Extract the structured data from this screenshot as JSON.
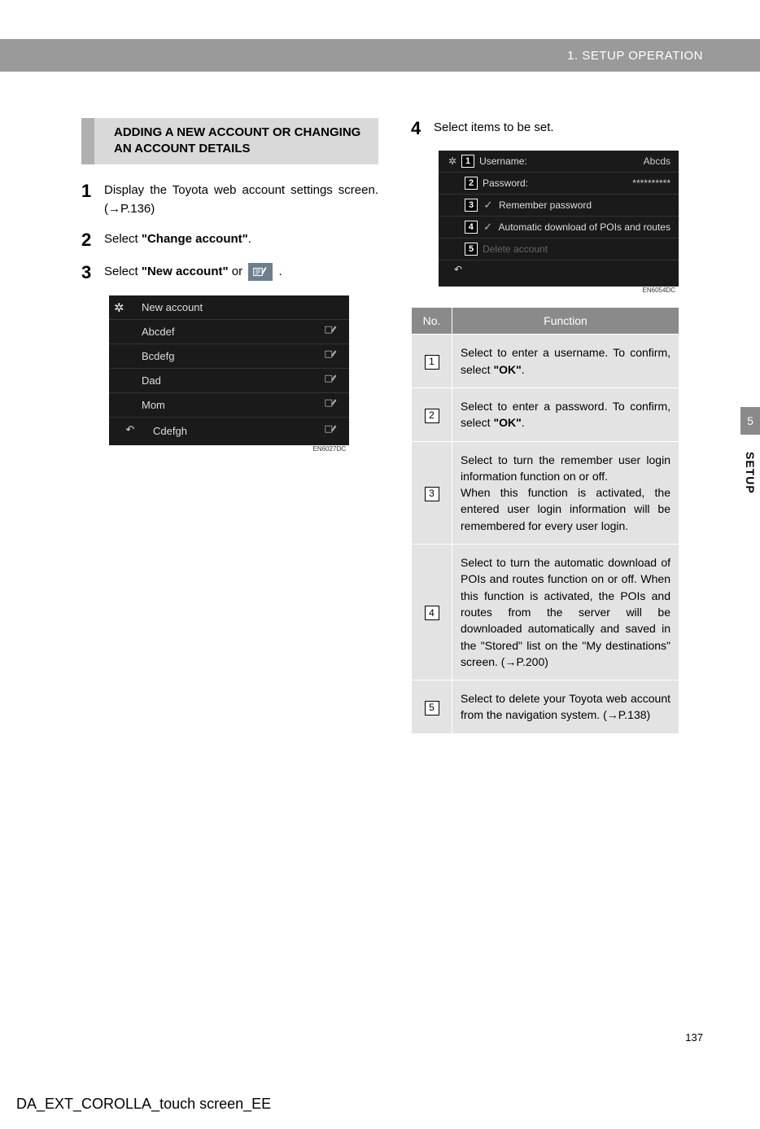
{
  "header": {
    "breadcrumb": "1. SETUP OPERATION"
  },
  "left": {
    "subheading": "ADDING A NEW ACCOUNT OR CHANGING AN ACCOUNT DETAILS",
    "steps": {
      "s1": {
        "num": "1",
        "text_a": "Display the Toyota web account settings screen. (",
        "text_b": "P.136)"
      },
      "s2": {
        "num": "2",
        "text_a": "Select ",
        "bold": "\"Change account\"",
        "text_b": "."
      },
      "s3": {
        "num": "3",
        "text_a": "Select ",
        "bold": "\"New account\"",
        "text_b": " or ",
        "text_c": " ."
      }
    },
    "screenshot": {
      "rows": [
        "New account",
        "Abcdef",
        "Bcdefg",
        "Dad",
        "Mom",
        "Cdefgh"
      ],
      "code": "EN6027DC"
    }
  },
  "right": {
    "step4": {
      "num": "4",
      "text": "Select items to be set."
    },
    "screenshot": {
      "r1": {
        "n": "1",
        "label": "Username:",
        "value": "Abcds"
      },
      "r2": {
        "n": "2",
        "label": "Password:",
        "value": "**********"
      },
      "r3": {
        "n": "3",
        "label": "Remember password"
      },
      "r4": {
        "n": "4",
        "label": "Automatic download of POIs and routes"
      },
      "r5": {
        "n": "5",
        "label": "Delete account"
      },
      "code": "EN6054DC"
    },
    "table": {
      "head_no": "No.",
      "head_func": "Function",
      "rows": {
        "r1": {
          "n": "1",
          "text_a": "Select to enter a username. To confirm, select ",
          "bold": "\"OK\"",
          "text_b": "."
        },
        "r2": {
          "n": "2",
          "text_a": "Select to enter a password. To confirm, select ",
          "bold": "\"OK\"",
          "text_b": "."
        },
        "r3": {
          "n": "3",
          "text_a": "Select to turn the remember user login information function on or off.",
          "text_b": "When this function is activated, the entered user login information will be remembered for every user login."
        },
        "r4": {
          "n": "4",
          "text_a": "Select to turn the automatic download of POIs and routes function on or off. When this function is activated, the POIs and routes from the server will be downloaded automatically and saved in the \"Stored\" list on the \"My destinations\" screen. (",
          "text_b": "P.200)"
        },
        "r5": {
          "n": "5",
          "text_a": "Select to delete your Toyota web account from the navigation system. (",
          "text_b": "P.138)"
        }
      }
    }
  },
  "side": {
    "chapter": "5",
    "label": "SETUP"
  },
  "page_number": "137",
  "footer": "DA_EXT_COROLLA_touch screen_EE"
}
